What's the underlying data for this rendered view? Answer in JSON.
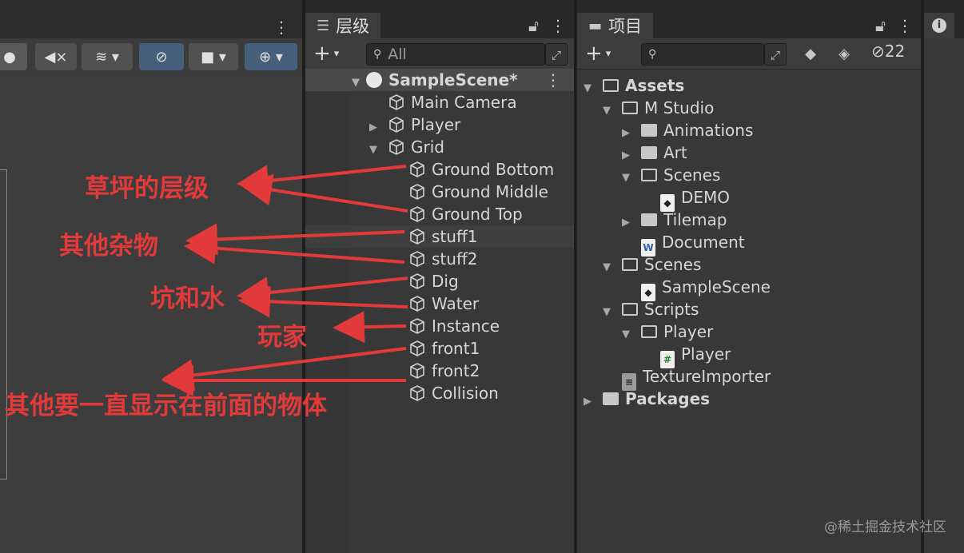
{
  "scene_panel": {
    "toolbar_buttons": [
      "light-bulb-icon",
      "audio-mute-icon",
      "effects-icon",
      "visibility-hidden-icon",
      "camera-icon",
      "gizmo-globe-icon"
    ]
  },
  "hierarchy": {
    "tab_title": "层级",
    "search_placeholder": "All",
    "scene_name": "SampleScene*",
    "items": [
      {
        "label": "Main Camera",
        "depth": 1,
        "arrow": ""
      },
      {
        "label": "Player",
        "depth": 1,
        "arrow": "▶"
      },
      {
        "label": "Grid",
        "depth": 1,
        "arrow": "▼"
      },
      {
        "label": "Ground Bottom",
        "depth": 2,
        "arrow": ""
      },
      {
        "label": "Ground Middle",
        "depth": 2,
        "arrow": ""
      },
      {
        "label": "Ground Top",
        "depth": 2,
        "arrow": ""
      },
      {
        "label": "stuff1",
        "depth": 2,
        "arrow": ""
      },
      {
        "label": "stuff2",
        "depth": 2,
        "arrow": ""
      },
      {
        "label": "Dig",
        "depth": 2,
        "arrow": ""
      },
      {
        "label": "Water",
        "depth": 2,
        "arrow": ""
      },
      {
        "label": "Instance",
        "depth": 2,
        "arrow": ""
      },
      {
        "label": "front1",
        "depth": 2,
        "arrow": ""
      },
      {
        "label": "front2",
        "depth": 2,
        "arrow": ""
      },
      {
        "label": "Collision",
        "depth": 2,
        "arrow": ""
      }
    ]
  },
  "project": {
    "tab_title": "项目",
    "hidden_count": "22",
    "items": [
      {
        "label": "Assets",
        "depth": 0,
        "arrow": "▼",
        "icon": "folder-open",
        "bold": true
      },
      {
        "label": "M Studio",
        "depth": 1,
        "arrow": "▼",
        "icon": "folder-open",
        "bold": false
      },
      {
        "label": "Animations",
        "depth": 2,
        "arrow": "▶",
        "icon": "folder",
        "bold": false
      },
      {
        "label": "Art",
        "depth": 2,
        "arrow": "▶",
        "icon": "folder",
        "bold": false
      },
      {
        "label": "Scenes",
        "depth": 2,
        "arrow": "▼",
        "icon": "folder-open",
        "bold": false
      },
      {
        "label": "DEMO",
        "depth": 3,
        "arrow": "",
        "icon": "unity-scene",
        "bold": false
      },
      {
        "label": "Tilemap",
        "depth": 2,
        "arrow": "▶",
        "icon": "folder",
        "bold": false
      },
      {
        "label": "Document",
        "depth": 2,
        "arrow": "",
        "icon": "word-doc",
        "bold": false
      },
      {
        "label": "Scenes",
        "depth": 1,
        "arrow": "▼",
        "icon": "folder-open",
        "bold": false
      },
      {
        "label": "SampleScene",
        "depth": 2,
        "arrow": "",
        "icon": "unity-scene",
        "bold": false
      },
      {
        "label": "Scripts",
        "depth": 1,
        "arrow": "▼",
        "icon": "folder-open",
        "bold": false
      },
      {
        "label": "Player",
        "depth": 2,
        "arrow": "▼",
        "icon": "folder-open",
        "bold": false
      },
      {
        "label": "Player",
        "depth": 3,
        "arrow": "",
        "icon": "csharp-script",
        "bold": false
      },
      {
        "label": "TextureImporter",
        "depth": 1,
        "arrow": "",
        "icon": "asset",
        "bold": false
      },
      {
        "label": "Packages",
        "depth": 0,
        "arrow": "▶",
        "icon": "folder",
        "bold": true
      }
    ]
  },
  "annotations": [
    "草坪的层级",
    "其他杂物",
    "坑和水",
    "玩家",
    "其他要一直显示在前面的物体"
  ],
  "watermark": "@稀土掘金技术社区",
  "colors": {
    "annotation": "#e23a3a",
    "panel": "#383838",
    "toolbar_active": "#46607c"
  }
}
